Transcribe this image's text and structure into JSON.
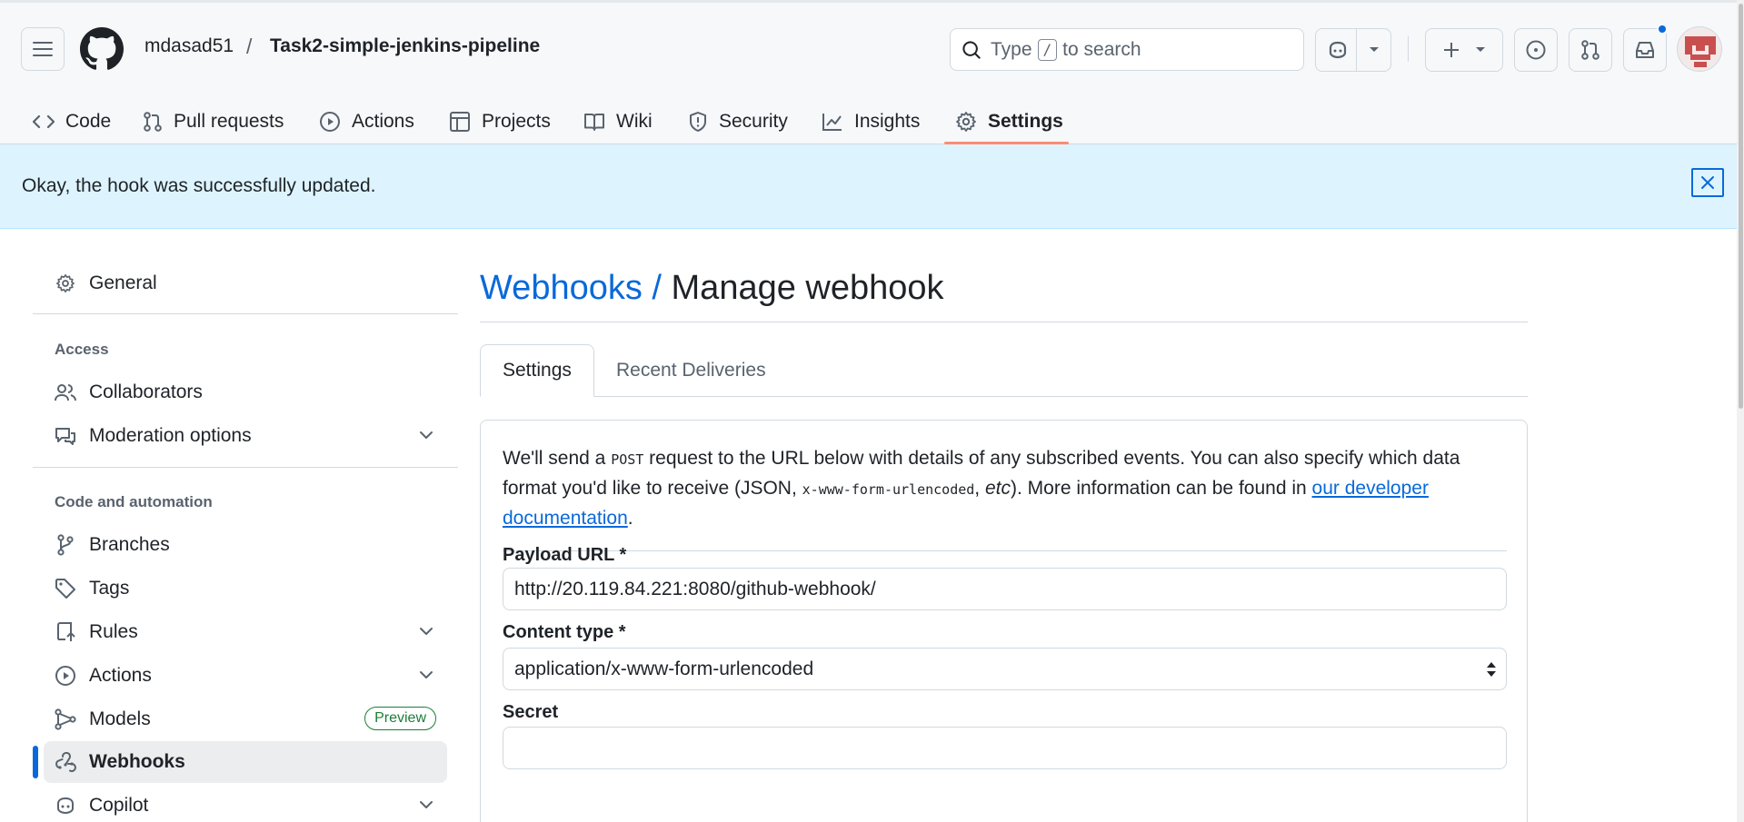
{
  "header": {
    "owner": "mdasad51",
    "separator": "/",
    "repo": "Task2-simple-jenkins-pipeline",
    "search": {
      "prefix": "Type",
      "key": "/",
      "suffix": "to search"
    }
  },
  "tabs": [
    {
      "label": "Code",
      "icon": "code-icon"
    },
    {
      "label": "Pull requests",
      "icon": "pull-request-icon"
    },
    {
      "label": "Actions",
      "icon": "play-circle-icon"
    },
    {
      "label": "Projects",
      "icon": "table-icon"
    },
    {
      "label": "Wiki",
      "icon": "book-icon"
    },
    {
      "label": "Security",
      "icon": "shield-icon"
    },
    {
      "label": "Insights",
      "icon": "graph-icon"
    },
    {
      "label": "Settings",
      "icon": "gear-icon",
      "active": true
    }
  ],
  "flash": {
    "message": "Okay, the hook was successfully updated."
  },
  "sidebar": {
    "general": "General",
    "access_heading": "Access",
    "collaborators": "Collaborators",
    "moderation": "Moderation options",
    "code_heading": "Code and automation",
    "branches": "Branches",
    "tags": "Tags",
    "rules": "Rules",
    "actions": "Actions",
    "models": "Models",
    "models_badge": "Preview",
    "webhooks": "Webhooks",
    "copilot": "Copilot"
  },
  "main": {
    "title_link": "Webhooks /",
    "title": "Manage webhook",
    "subtabs": {
      "settings": "Settings",
      "recent": "Recent Deliveries"
    },
    "intro": {
      "part1": "We'll send a",
      "method": "POST",
      "part2": "request to the URL below with details of any subscribed events. You can also specify which data format you'd like to receive (JSON,",
      "format": "x-www-form-urlencoded",
      "part3": ",",
      "etc": "etc",
      "part4": "). More information can be found in",
      "link": "our developer documentation",
      "part5": "."
    },
    "payload_label": "Payload URL *",
    "payload_value": "http://20.119.84.221:8080/github-webhook/",
    "content_label": "Content type *",
    "content_value": "application/x-www-form-urlencoded",
    "secret_label": "Secret",
    "secret_value": ""
  },
  "colors": {
    "accent": "#0969da",
    "flash_bg": "#ddf4ff",
    "tab_underline": "#fd8c73",
    "preview_badge": "#1a7f37"
  }
}
